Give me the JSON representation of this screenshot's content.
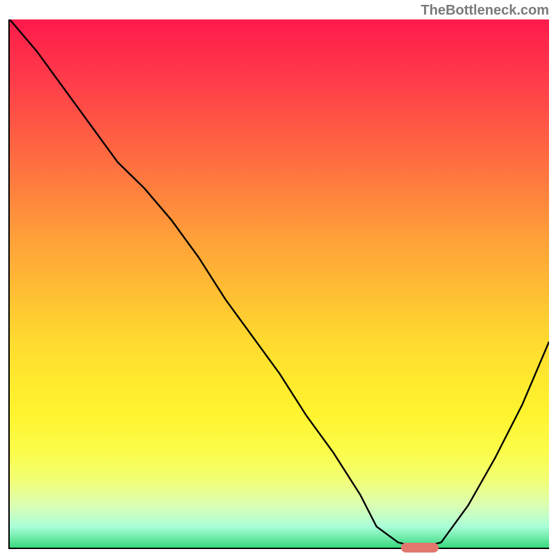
{
  "watermark": "TheBottleneck.com",
  "chart_data": {
    "type": "line",
    "title": "",
    "xlabel": "",
    "ylabel": "",
    "xlim": [
      0,
      100
    ],
    "ylim": [
      0,
      100
    ],
    "grid": false,
    "series": [
      {
        "name": "curve",
        "x": [
          0,
          5,
          10,
          15,
          20,
          25,
          30,
          35,
          40,
          45,
          50,
          55,
          60,
          65,
          68,
          72,
          76,
          80,
          85,
          90,
          95,
          100
        ],
        "y": [
          100,
          94,
          87,
          80,
          73,
          68,
          62,
          55,
          47,
          40,
          33,
          25,
          18,
          10,
          4,
          1,
          0,
          1,
          8,
          17,
          27,
          39
        ]
      }
    ],
    "marker": {
      "x_center": 76,
      "y": 0,
      "width_pct": 7
    }
  },
  "colors": {
    "curve": "#000000",
    "marker": "#e2786d",
    "axis": "#000000"
  }
}
